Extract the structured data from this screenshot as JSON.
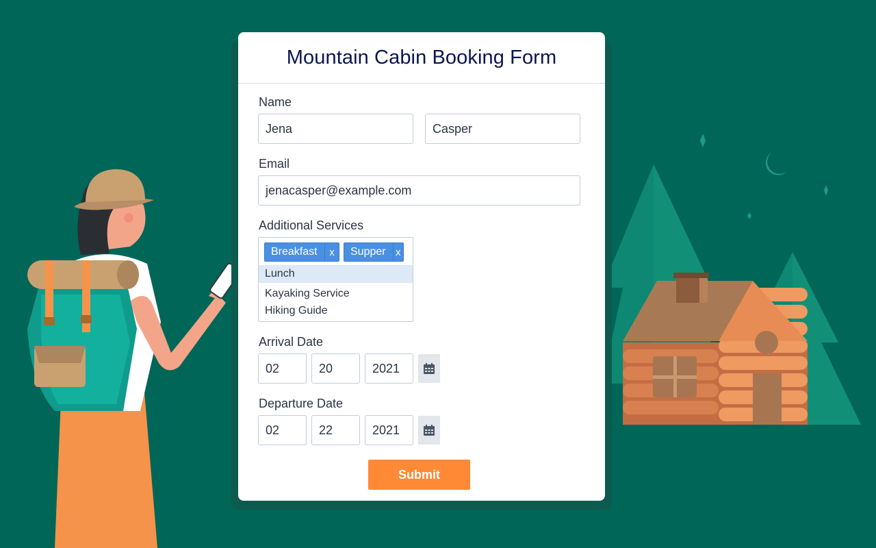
{
  "form": {
    "title": "Mountain Cabin Booking Form",
    "name_label": "Name",
    "first_name": "Jena",
    "last_name": "Casper",
    "email_label": "Email",
    "email": "jenacasper@example.com",
    "services_label": "Additional Services",
    "selected_services": [
      "Breakfast",
      "Supper"
    ],
    "tag_remove": "x",
    "service_options": [
      "Lunch",
      "Kayaking Service",
      "Hiking Guide"
    ],
    "arrival_label": "Arrival Date",
    "arrival": {
      "month": "02",
      "day": "20",
      "year": "2021"
    },
    "departure_label": "Departure Date",
    "departure": {
      "month": "02",
      "day": "22",
      "year": "2021"
    },
    "submit_label": "Submit"
  },
  "icons": {
    "calendar": "calendar-icon",
    "close": "close-icon"
  },
  "colors": {
    "background": "#006657",
    "card": "#ffffff",
    "title": "#0a1551",
    "tag": "#4a90e2",
    "highlight": "#dde9f7",
    "submit": "#ff8934"
  }
}
